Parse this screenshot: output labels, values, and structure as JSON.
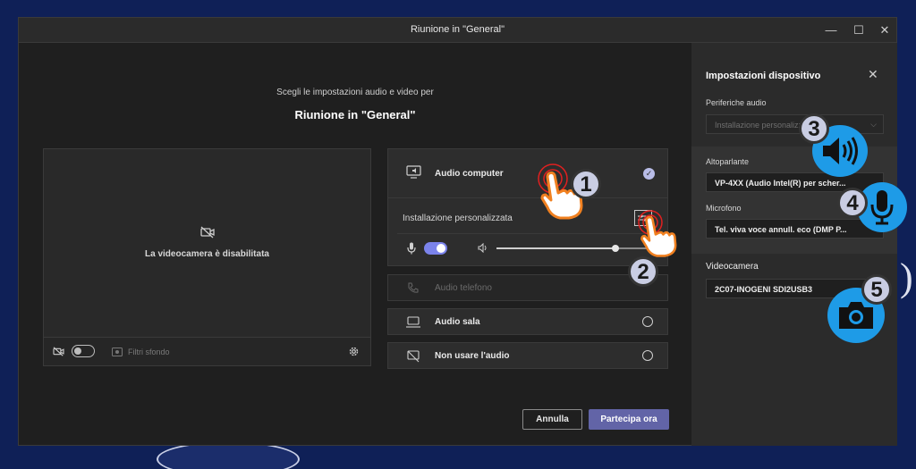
{
  "window": {
    "title": "Riunione in \"General\""
  },
  "main": {
    "subtitle": "Scegli le impostazioni audio e video per",
    "meeting_name": "Riunione in \"General\"",
    "camera_off_text": "La videocamera è disabilitata",
    "background_filters_label": "Filtri sfondo"
  },
  "audio_options": {
    "computer_audio": "Audio computer",
    "custom_setup": "Installazione personalizzata",
    "phone_audio": "Audio telefono",
    "room_audio": "Audio sala",
    "no_audio": "Non usare l'audio",
    "mic_toggle_on": true,
    "volume_level": 0.78
  },
  "actions": {
    "cancel": "Annulla",
    "join_now": "Partecipa ora"
  },
  "device_settings": {
    "title": "Impostazioni dispositivo",
    "audio_devices_label": "Periferiche audio",
    "audio_devices_value": "Installazione personalizzata",
    "speaker_label": "Altoparlante",
    "speaker_value": "VP-4XX (Audio Intel(R) per scher...",
    "microphone_label": "Microfono",
    "microphone_value": "Tel. viva voce annull. eco (DMP P...",
    "camera_label": "Videocamera",
    "camera_value": "2C07-INOGENI SDI2USB3"
  },
  "annotations": {
    "badge1": "1",
    "badge2": "2",
    "badge3": "3",
    "badge4": "4",
    "badge5": "5"
  },
  "colors": {
    "accent": "#6264a7",
    "callout_blue": "#1e9be7",
    "click_red": "#e02020",
    "hand_orange": "#f08020"
  }
}
